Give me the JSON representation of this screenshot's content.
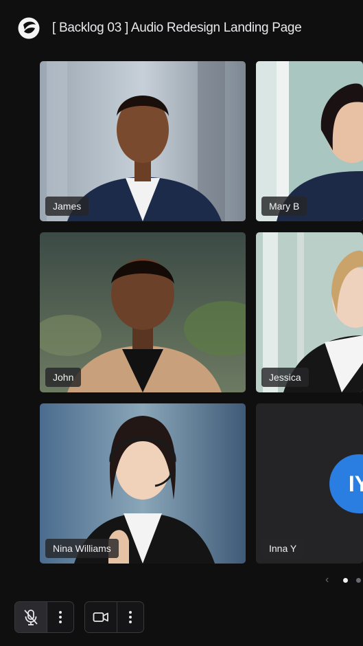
{
  "header": {
    "title": "[ Backlog 03 ] Audio Redesign Landing Page",
    "logo_icon": "sphere-logo-icon"
  },
  "participants": [
    {
      "name": "James",
      "type": "video"
    },
    {
      "name": "Mary B",
      "type": "video"
    },
    {
      "name": "John",
      "type": "video"
    },
    {
      "name": "Jessica",
      "type": "video"
    },
    {
      "name": "Nina Williams",
      "type": "video"
    },
    {
      "name": "Inna Y",
      "type": "avatar",
      "initials": "IY",
      "avatar_color": "#2a7de1"
    }
  ],
  "pager": {
    "icon": "chevron-left-icon",
    "current_page": 1,
    "total_visible_dots": 2
  },
  "controls": {
    "mic": {
      "icon": "mic-off-icon",
      "state": "muted"
    },
    "mic_menu_icon": "more-vertical-icon",
    "camera": {
      "icon": "video-camera-icon"
    },
    "camera_menu_icon": "more-vertical-icon"
  },
  "colors": {
    "background": "#0f0f10",
    "tile_name_bg": "#262628",
    "avatar_blue": "#2a7de1",
    "text": "#e9e9eb"
  }
}
